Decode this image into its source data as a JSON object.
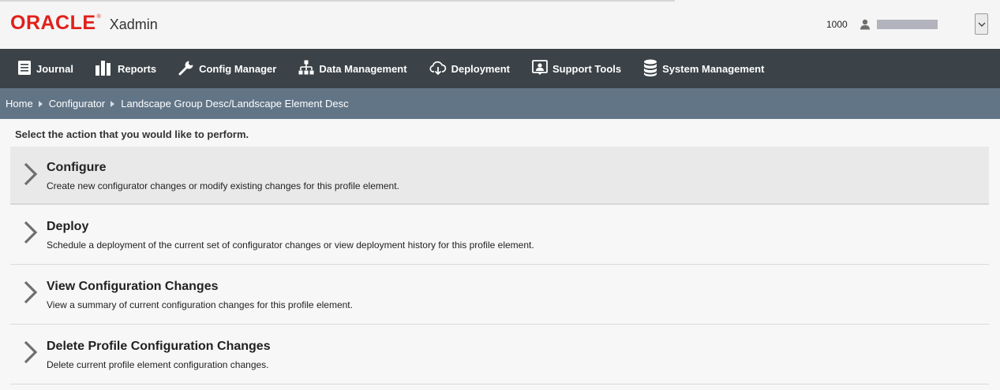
{
  "header": {
    "logo_text": "ORACLE",
    "app_name": "Xadmin",
    "store_number": "1000",
    "user_icon": "user-icon",
    "dropdown_icon": "chevron-down-icon"
  },
  "nav": {
    "items": [
      {
        "label": "Journal",
        "icon": "journal-icon"
      },
      {
        "label": "Reports",
        "icon": "bar-chart-icon"
      },
      {
        "label": "Config Manager",
        "icon": "wrench-icon"
      },
      {
        "label": "Data Management",
        "icon": "hierarchy-icon"
      },
      {
        "label": "Deployment",
        "icon": "cloud-download-icon"
      },
      {
        "label": "Support Tools",
        "icon": "support-icon"
      },
      {
        "label": "System Management",
        "icon": "database-icon"
      }
    ]
  },
  "breadcrumb": {
    "items": [
      "Home",
      "Configurator",
      "Landscape Group Desc/Landscape Element Desc"
    ]
  },
  "main": {
    "prompt": "Select the action that you would like to perform.",
    "actions": [
      {
        "title": "Configure",
        "description": "Create new configurator changes or modify existing changes for this profile element."
      },
      {
        "title": "Deploy",
        "description": "Schedule a deployment of the current set of configurator changes or view deployment history for this profile element."
      },
      {
        "title": "View Configuration Changes",
        "description": "View a summary of current configuration changes for this profile element."
      },
      {
        "title": "Delete Profile Configuration Changes",
        "description": "Delete current profile element configuration changes."
      }
    ]
  },
  "colors": {
    "brand_red": "#e0201b",
    "nav_bg": "#3b4348",
    "breadcrumb_bg": "#627587",
    "hover_row_bg": "#e9e9ea"
  }
}
